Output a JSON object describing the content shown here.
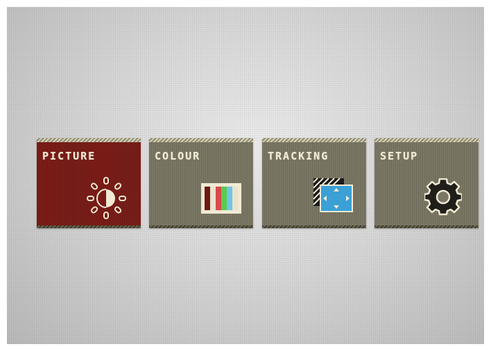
{
  "menu": {
    "items": [
      {
        "label": "PICTURE",
        "icon": "brightness-icon",
        "selected": true
      },
      {
        "label": "COLOUR",
        "icon": "color-bars-icon",
        "selected": false
      },
      {
        "label": "TRACKING",
        "icon": "position-arrows-icon",
        "selected": false
      },
      {
        "label": "SETUP",
        "icon": "gear-icon",
        "selected": false
      }
    ]
  },
  "colors": {
    "selected_tile": "#7a1d18",
    "tile": "#7a7764",
    "label_text": "#f1ead4",
    "icon_blue": "#3aa0d6"
  }
}
